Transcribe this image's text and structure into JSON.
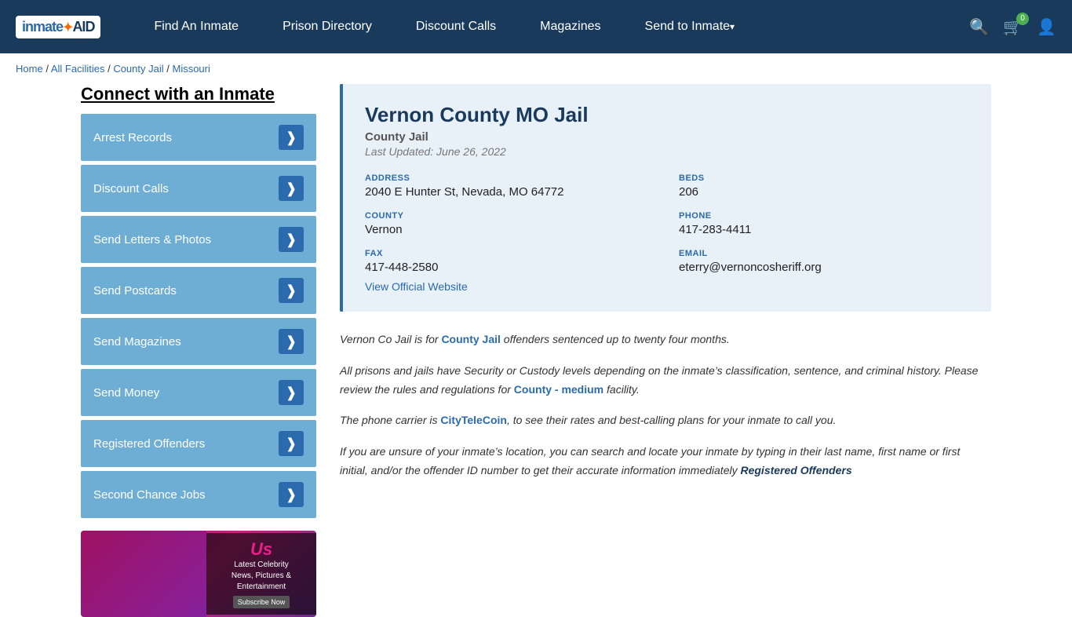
{
  "navbar": {
    "logo_text": "inmateAID",
    "links": [
      {
        "label": "Find An Inmate",
        "id": "find-inmate",
        "dropdown": false
      },
      {
        "label": "Prison Directory",
        "id": "prison-directory",
        "dropdown": false
      },
      {
        "label": "Discount Calls",
        "id": "discount-calls",
        "dropdown": false
      },
      {
        "label": "Magazines",
        "id": "magazines",
        "dropdown": false
      },
      {
        "label": "Send to Inmate",
        "id": "send-to-inmate",
        "dropdown": true
      }
    ],
    "cart_count": "0"
  },
  "breadcrumb": {
    "items": [
      {
        "label": "Home",
        "href": "#"
      },
      {
        "label": "All Facilities",
        "href": "#"
      },
      {
        "label": "County Jail",
        "href": "#"
      },
      {
        "label": "Missouri",
        "href": "#"
      }
    ]
  },
  "sidebar": {
    "title": "Connect with an Inmate",
    "buttons": [
      {
        "label": "Arrest Records",
        "id": "arrest-records"
      },
      {
        "label": "Discount Calls",
        "id": "discount-calls-btn"
      },
      {
        "label": "Send Letters & Photos",
        "id": "send-letters"
      },
      {
        "label": "Send Postcards",
        "id": "send-postcards"
      },
      {
        "label": "Send Magazines",
        "id": "send-magazines"
      },
      {
        "label": "Send Money",
        "id": "send-money"
      },
      {
        "label": "Registered Offenders",
        "id": "registered-offenders"
      },
      {
        "label": "Second Chance Jobs",
        "id": "second-chance-jobs"
      }
    ]
  },
  "facility": {
    "name": "Vernon County MO Jail",
    "type": "County Jail",
    "last_updated": "Last Updated: June 26, 2022",
    "address_label": "ADDRESS",
    "address_value": "2040 E Hunter St, Nevada, MO 64772",
    "beds_label": "BEDS",
    "beds_value": "206",
    "county_label": "COUNTY",
    "county_value": "Vernon",
    "phone_label": "PHONE",
    "phone_value": "417-283-4411",
    "fax_label": "FAX",
    "fax_value": "417-448-2580",
    "email_label": "EMAIL",
    "email_value": "eterry@vernoncosheriff.org",
    "website_label": "View Official Website"
  },
  "description": {
    "para1_before": "Vernon Co Jail is for ",
    "para1_highlight": "County Jail",
    "para1_after": " offenders sentenced up to twenty four months.",
    "para2": "All prisons and jails have Security or Custody levels depending on the inmate’s classification, sentence, and criminal history. Please review the rules and regulations for ",
    "para2_highlight": "County - medium",
    "para2_after": " facility.",
    "para3_before": "The phone carrier is ",
    "para3_highlight": "CityTeleCoin",
    "para3_after": ", to see their rates and best-calling plans for your inmate to call you.",
    "para4": "If you are unsure of your inmate’s location, you can search and locate your inmate by typing in their last name, first name or first initial, and/or the offender ID number to get their accurate information immediately ",
    "para4_highlight": "Registered Offenders"
  },
  "ad": {
    "brand": "Us",
    "line1": "Latest Celebrity",
    "line2": "News, Pictures &",
    "line3": "Entertainment",
    "btn_label": "Subscribe Now"
  }
}
